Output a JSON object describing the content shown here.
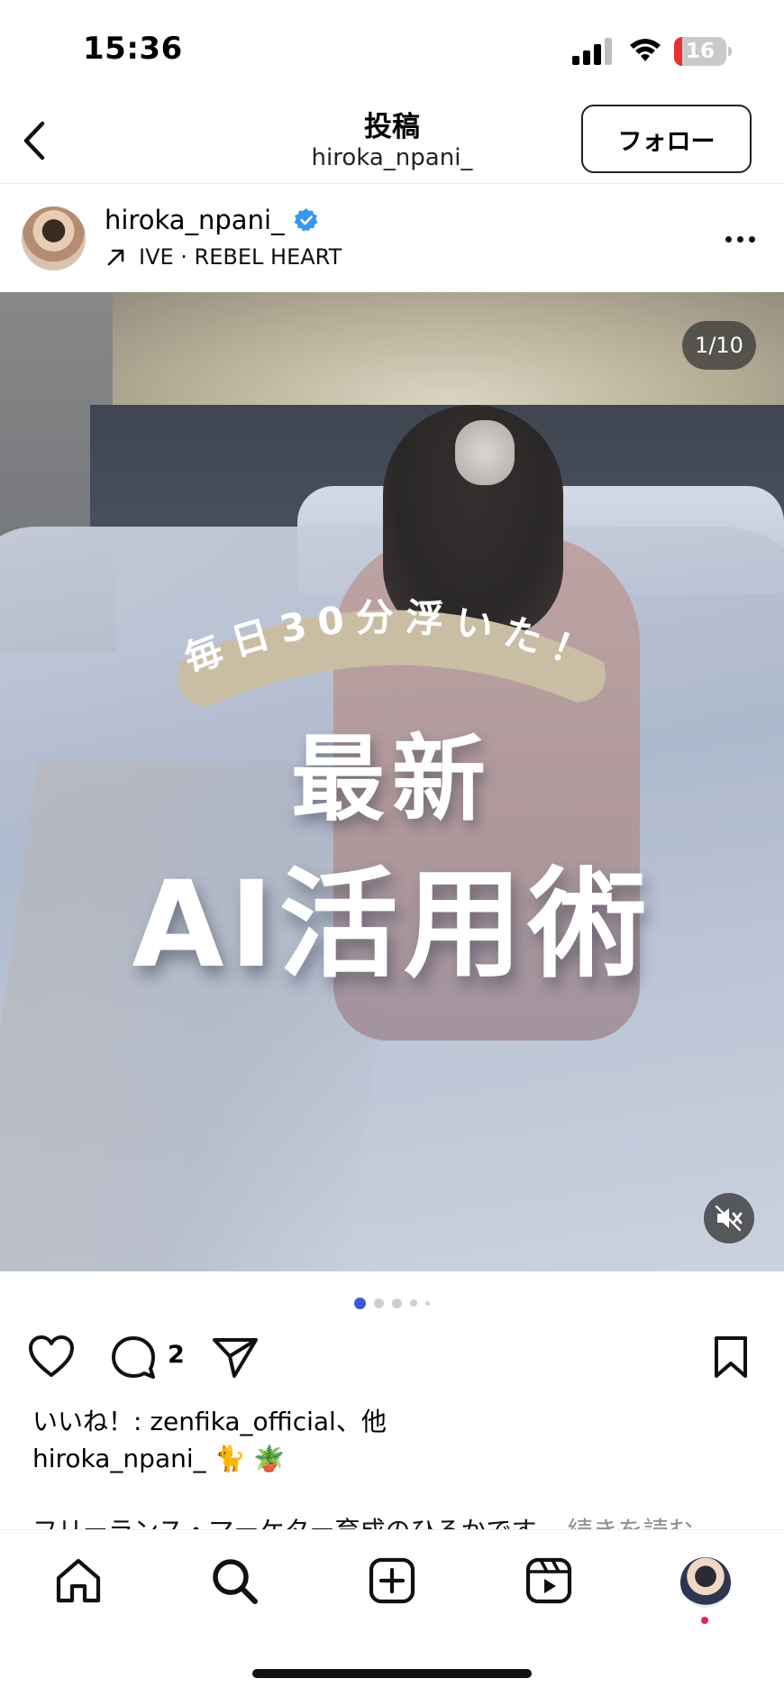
{
  "status_bar": {
    "time": "15:36",
    "battery": "16",
    "battery_level": 0.16,
    "battery_color": "#e5322d"
  },
  "header": {
    "title": "投稿",
    "subtitle": "hiroka_npani_",
    "follow_label": "フォロー"
  },
  "post": {
    "author": "hiroka_npani_",
    "music": "IVE · REBEL HEART",
    "image_counter": "1/10",
    "banner_text": "毎日30分浮いた！",
    "headline_line1": "最新",
    "headline_line2": "AI活用術",
    "dots": {
      "count": 5,
      "active": 0,
      "active_color": "#3a5bd9"
    },
    "comment_count": "2",
    "likes_text": "いいね！: zenfika_official、他",
    "caption_user": "hiroka_npani_ 🐈 🪴",
    "caption_text": "フリーランス・マーケター育成のひろかです。",
    "caption_more": "続きを読む"
  },
  "icons": [
    "chevron-left-icon",
    "verified-badge-icon",
    "arrow-up-right-icon",
    "more-icon",
    "mute-icon",
    "heart-icon",
    "comment-icon",
    "share-icon",
    "bookmark-icon",
    "home-icon",
    "search-icon",
    "create-icon",
    "reels-icon"
  ],
  "colors": {
    "verified": "#3897f0",
    "banner_bg": "#c9bda3",
    "banner_text": "#ffffff"
  }
}
